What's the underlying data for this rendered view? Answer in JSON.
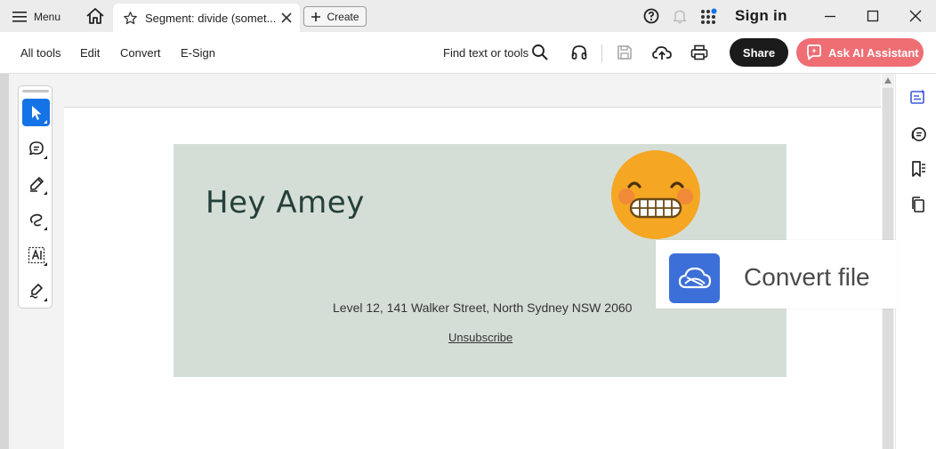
{
  "titlebar": {
    "menu_label": "Menu",
    "tab_title": "Segment: divide (somet...",
    "create_label": "Create",
    "signin_label": "Sign in"
  },
  "toolbar": {
    "items": [
      "All tools",
      "Edit",
      "Convert",
      "E-Sign"
    ],
    "find_label": "Find text or tools",
    "share_label": "Share",
    "ai_label": "Ask AI Assistant"
  },
  "email": {
    "greeting": "Hey Amey",
    "address": "Level 12, 141 Walker Street, North Sydney NSW 2060",
    "unsubscribe": "Unsubscribe"
  },
  "overlay": {
    "convert_label": "Convert file"
  },
  "icons": {
    "menu": "hamburger-icon",
    "home": "home-icon",
    "star": "star-icon",
    "close": "close-icon",
    "plus": "plus-icon",
    "help": "help-icon",
    "bell": "bell-icon",
    "apps": "apps-grid-icon",
    "search": "search-icon",
    "audio": "headphones-icon",
    "save": "save-icon",
    "upload": "cloud-upload-icon",
    "print": "print-icon",
    "ai": "ai-assistant-icon",
    "select": "cursor-icon",
    "comment": "comment-icon",
    "highlight": "pen-icon",
    "lasso": "lasso-icon",
    "textselect": "text-select-icon",
    "sign": "sign-icon",
    "emoji": "grimacing-emoji-icon",
    "convert": "cloud-convert-icon"
  },
  "colors": {
    "accent": "#1473e6",
    "ai_button": "#ee6e74",
    "share_button": "#1b1b1b",
    "card_background": "#d5ded6",
    "emoji_face": "#f5a623",
    "convert_icon_bg": "#3c6fd8"
  }
}
